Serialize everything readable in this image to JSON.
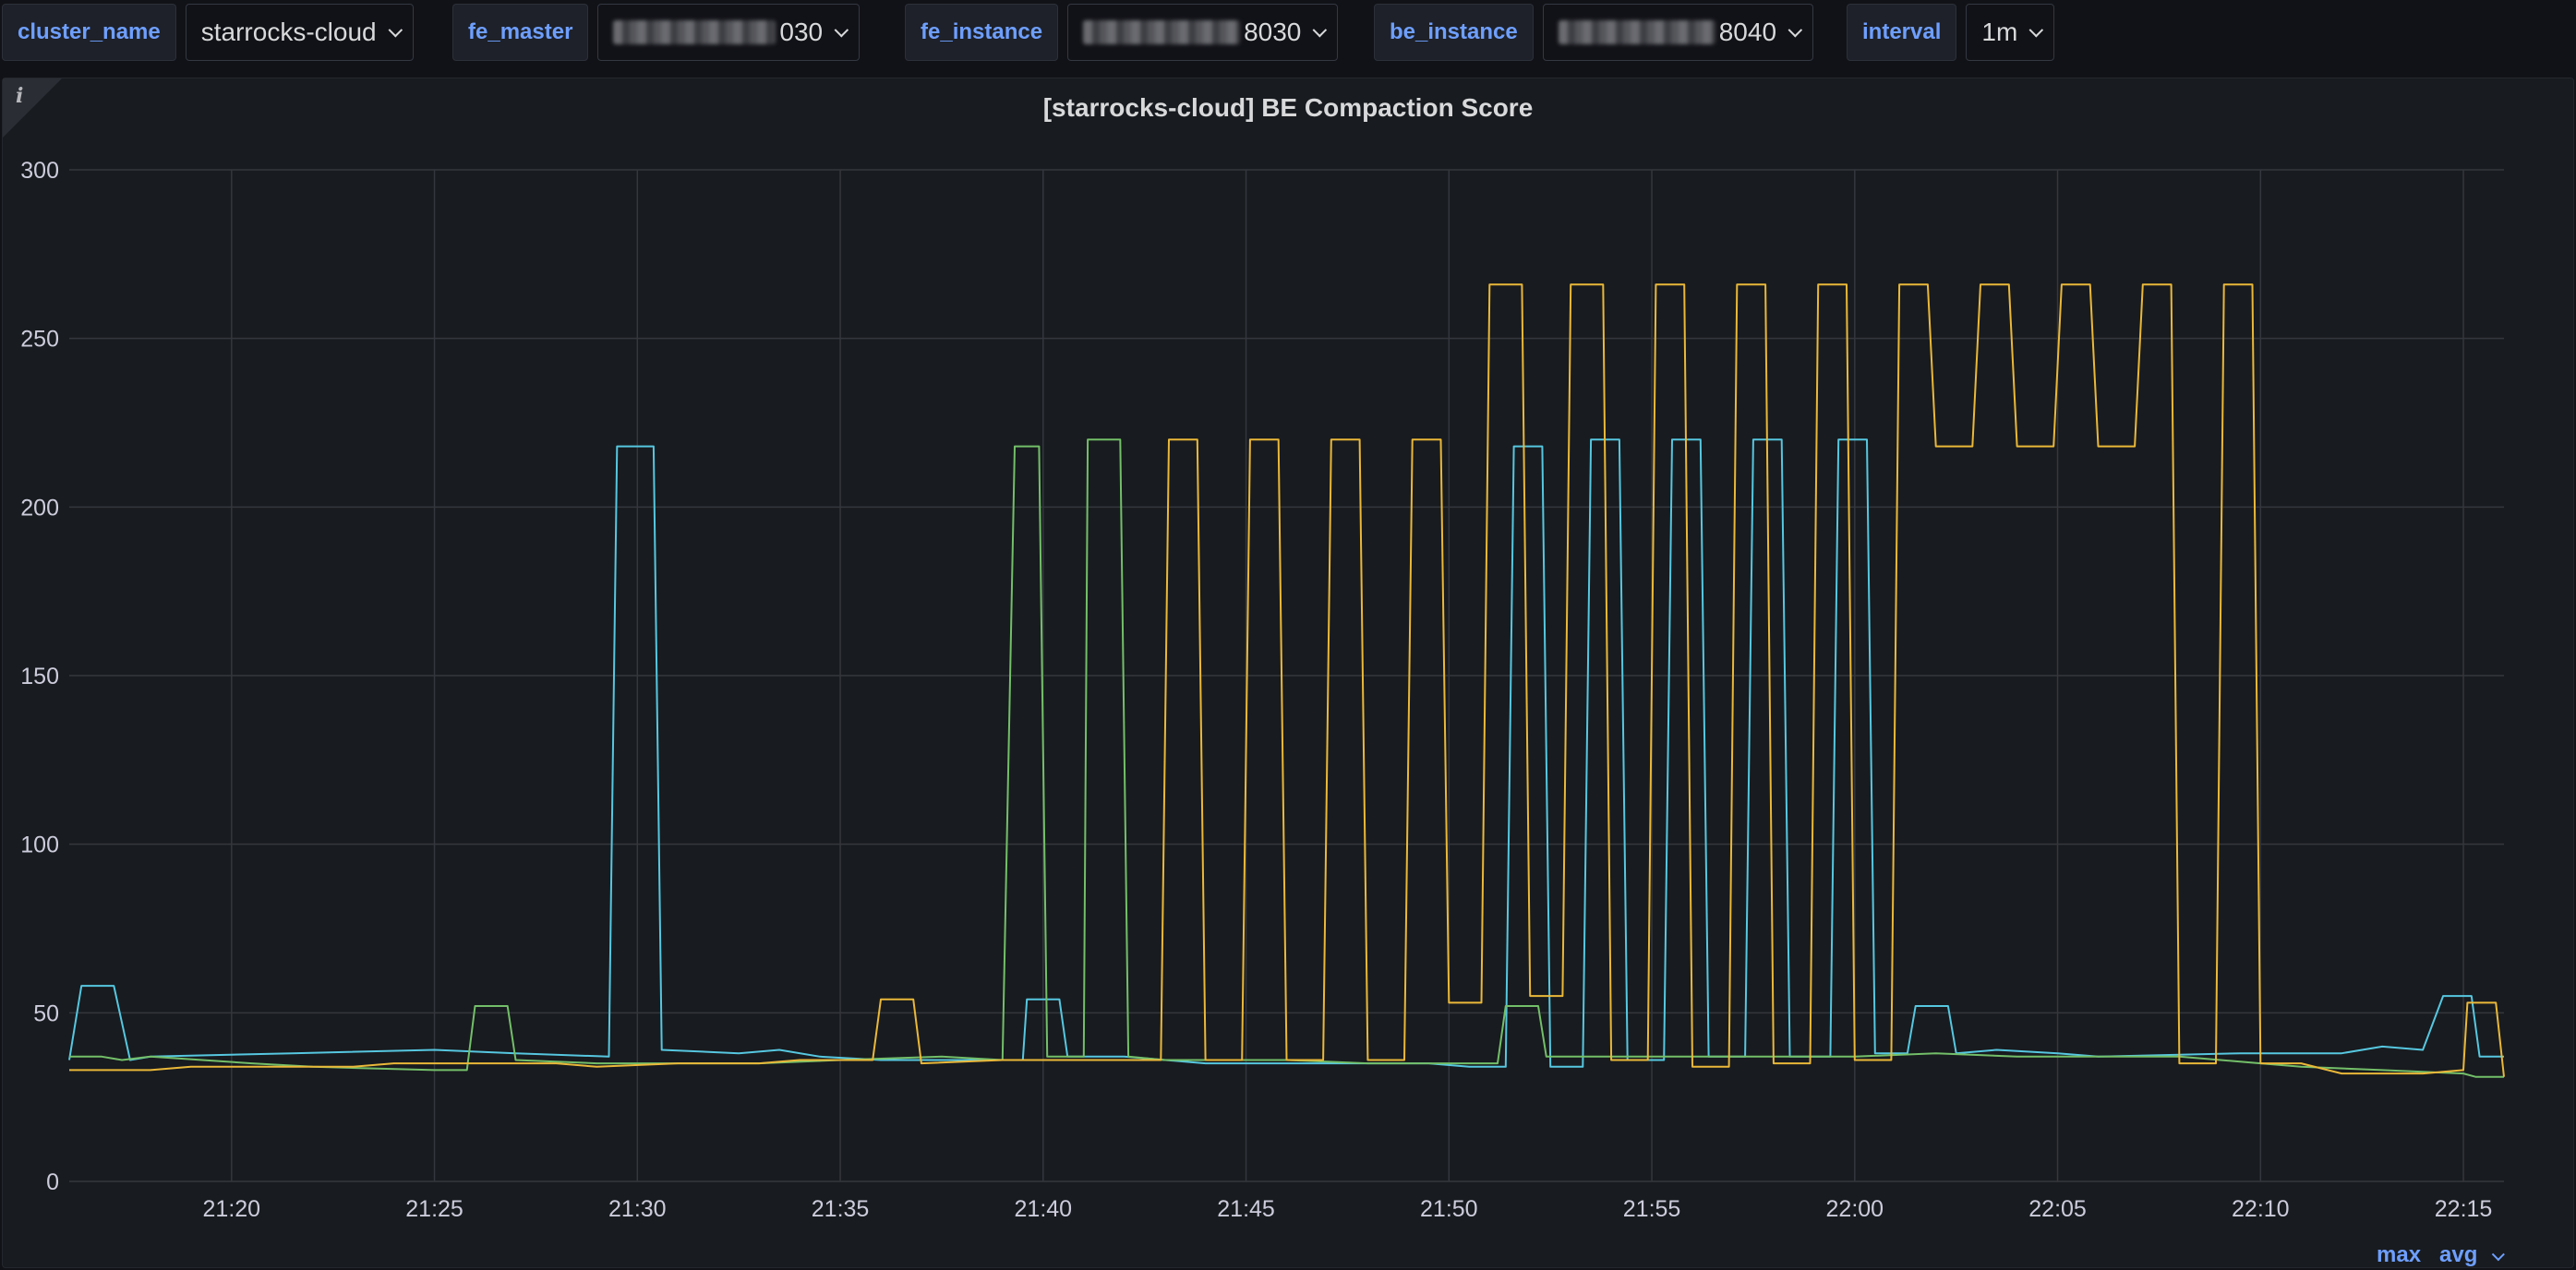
{
  "variables": [
    {
      "label": "cluster_name",
      "value": "starrocks-cloud",
      "masked": false
    },
    {
      "label": "fe_master",
      "value": "030",
      "masked": true
    },
    {
      "label": "fe_instance",
      "value": "8030",
      "masked": true
    },
    {
      "label": "be_instance",
      "value": "8040",
      "masked": true
    },
    {
      "label": "interval",
      "value": "1m",
      "masked": false
    }
  ],
  "panel": {
    "title": "[starrocks-cloud] BE Compaction Score",
    "info_icon": "info-icon",
    "legend_controls": [
      "max",
      "avg"
    ]
  },
  "colors": {
    "background": "#111217",
    "panel": "#181b1f",
    "accent": "#6e9fff",
    "grid": "#34373d"
  },
  "chart_data": {
    "type": "line",
    "title": "[starrocks-cloud] BE Compaction Score",
    "xlabel": "",
    "ylabel": "",
    "xlim": [
      "21:16",
      "22:16"
    ],
    "ylim": [
      0,
      300
    ],
    "y_ticks": [
      0,
      50,
      100,
      150,
      200,
      250,
      300
    ],
    "x_ticks": [
      "21:20",
      "21:25",
      "21:30",
      "21:35",
      "21:40",
      "21:45",
      "21:50",
      "21:55",
      "22:00",
      "22:05",
      "22:10",
      "22:15"
    ],
    "grid": true,
    "series": [
      {
        "color": "#56c7e0",
        "points": [
          [
            "21:16",
            36
          ],
          [
            "21:16.3",
            58
          ],
          [
            "21:17.1",
            58
          ],
          [
            "21:17.5",
            36
          ],
          [
            "21:18",
            37
          ],
          [
            "21:21.5",
            38
          ],
          [
            "21:25",
            39
          ],
          [
            "21:27",
            38
          ],
          [
            "21:29.3",
            37
          ],
          [
            "21:29.5",
            218
          ],
          [
            "21:30.4",
            218
          ],
          [
            "21:30.6",
            39
          ],
          [
            "21:32.5",
            38
          ],
          [
            "21:33.5",
            39
          ],
          [
            "21:34.5",
            37
          ],
          [
            "21:36",
            36
          ],
          [
            "21:39.5",
            36
          ],
          [
            "21:39.6",
            54
          ],
          [
            "21:40.4",
            54
          ],
          [
            "21:40.6",
            37
          ],
          [
            "21:42",
            37
          ],
          [
            "21:44",
            35
          ],
          [
            "21:47",
            35
          ],
          [
            "21:49.5",
            35
          ],
          [
            "21:50.5",
            34
          ],
          [
            "21:51.4",
            34
          ],
          [
            "21:51.6",
            218
          ],
          [
            "21:52.3",
            218
          ],
          [
            "21:52.5",
            34
          ],
          [
            "21:53.3",
            34
          ],
          [
            "21:53.5",
            220
          ],
          [
            "21:54.2",
            220
          ],
          [
            "21:54.4",
            36
          ],
          [
            "21:55.3",
            36
          ],
          [
            "21:55.5",
            220
          ],
          [
            "21:56.2",
            220
          ],
          [
            "21:56.4",
            37
          ],
          [
            "21:57.3",
            37
          ],
          [
            "21:57.5",
            220
          ],
          [
            "21:58.2",
            220
          ],
          [
            "21:58.4",
            37
          ],
          [
            "21:59.4",
            37
          ],
          [
            "21:59.6",
            220
          ],
          [
            "22:00.3",
            220
          ],
          [
            "22:00.5",
            38
          ],
          [
            "22:01.3",
            38
          ],
          [
            "22:01.5",
            52
          ],
          [
            "22:02.3",
            52
          ],
          [
            "22:02.5",
            38
          ],
          [
            "22:03.5",
            39
          ],
          [
            "22:05",
            38
          ],
          [
            "22:06",
            37
          ],
          [
            "22:09.5",
            38
          ],
          [
            "22:12",
            38
          ],
          [
            "22:13",
            40
          ],
          [
            "22:14",
            39
          ],
          [
            "22:14.5",
            55
          ],
          [
            "22:15.2",
            55
          ],
          [
            "22:15.4",
            37
          ],
          [
            "22:16",
            37
          ]
        ]
      },
      {
        "color": "#73bf69",
        "points": [
          [
            "21:16",
            37
          ],
          [
            "21:16.8",
            37
          ],
          [
            "21:17.3",
            36
          ],
          [
            "21:18",
            37
          ],
          [
            "21:20.5",
            35
          ],
          [
            "21:22",
            34
          ],
          [
            "21:25",
            33
          ],
          [
            "21:25.8",
            33
          ],
          [
            "21:26",
            52
          ],
          [
            "21:26.8",
            52
          ],
          [
            "21:27",
            36
          ],
          [
            "21:29",
            35
          ],
          [
            "21:31",
            35
          ],
          [
            "21:33",
            35
          ],
          [
            "21:35",
            36
          ],
          [
            "21:37.5",
            37
          ],
          [
            "21:39",
            36
          ],
          [
            "21:39.3",
            218
          ],
          [
            "21:39.9",
            218
          ],
          [
            "21:40.1",
            37
          ],
          [
            "21:41",
            37
          ],
          [
            "21:41.1",
            220
          ],
          [
            "21:41.9",
            220
          ],
          [
            "21:42.1",
            37
          ],
          [
            "21:43",
            36
          ],
          [
            "21:46",
            36
          ],
          [
            "21:48",
            35
          ],
          [
            "21:50",
            35
          ],
          [
            "21:51.2",
            35
          ],
          [
            "21:51.4",
            52
          ],
          [
            "21:52.2",
            52
          ],
          [
            "21:52.4",
            37
          ],
          [
            "21:55",
            37
          ],
          [
            "22:00",
            37
          ],
          [
            "22:02",
            38
          ],
          [
            "22:04",
            37
          ],
          [
            "22:06",
            37
          ],
          [
            "22:08",
            37
          ],
          [
            "22:10",
            35
          ],
          [
            "22:11",
            34
          ],
          [
            "22:13",
            33
          ],
          [
            "22:15",
            32
          ],
          [
            "22:15.3",
            31
          ],
          [
            "22:16",
            31
          ]
        ]
      },
      {
        "color": "#eab839",
        "points": [
          [
            "21:16",
            33
          ],
          [
            "21:18",
            33
          ],
          [
            "21:19",
            34
          ],
          [
            "21:21",
            34
          ],
          [
            "21:23",
            34
          ],
          [
            "21:24",
            35
          ],
          [
            "21:25.5",
            35
          ],
          [
            "21:26.5",
            35
          ],
          [
            "21:28",
            35
          ],
          [
            "21:29",
            34
          ],
          [
            "21:31",
            35
          ],
          [
            "21:33",
            35
          ],
          [
            "21:34",
            36
          ],
          [
            "21:35.8",
            36
          ],
          [
            "21:36",
            54
          ],
          [
            "21:36.8",
            54
          ],
          [
            "21:37",
            35
          ],
          [
            "21:39",
            36
          ],
          [
            "21:41",
            36
          ],
          [
            "21:42.9",
            36
          ],
          [
            "21:43.1",
            220
          ],
          [
            "21:43.8",
            220
          ],
          [
            "21:44",
            36
          ],
          [
            "21:44.9",
            36
          ],
          [
            "21:45.1",
            220
          ],
          [
            "21:45.8",
            220
          ],
          [
            "21:46",
            36
          ],
          [
            "21:46.9",
            36
          ],
          [
            "21:47.1",
            220
          ],
          [
            "21:47.8",
            220
          ],
          [
            "21:48",
            36
          ],
          [
            "21:48.9",
            36
          ],
          [
            "21:49.1",
            220
          ],
          [
            "21:49.8",
            220
          ],
          [
            "21:50",
            53
          ],
          [
            "21:50.8",
            53
          ],
          [
            "21:51",
            266
          ],
          [
            "21:51.8",
            266
          ],
          [
            "21:52",
            55
          ],
          [
            "21:52.8",
            55
          ],
          [
            "21:53",
            266
          ],
          [
            "21:53.8",
            266
          ],
          [
            "21:54",
            36
          ],
          [
            "21:54.9",
            36
          ],
          [
            "21:55.1",
            266
          ],
          [
            "21:55.8",
            266
          ],
          [
            "21:56",
            34
          ],
          [
            "21:56.9",
            34
          ],
          [
            "21:57.1",
            266
          ],
          [
            "21:57.8",
            266
          ],
          [
            "21:58",
            35
          ],
          [
            "21:58.9",
            35
          ],
          [
            "21:59.1",
            266
          ],
          [
            "21:59.8",
            266
          ],
          [
            "22:00",
            36
          ],
          [
            "22:00.9",
            36
          ],
          [
            "22:01.1",
            266
          ],
          [
            "22:01.8",
            266
          ],
          [
            "22:02",
            218
          ],
          [
            "22:02.9",
            218
          ],
          [
            "22:03.1",
            266
          ],
          [
            "22:03.8",
            266
          ],
          [
            "22:04",
            218
          ],
          [
            "22:04.9",
            218
          ],
          [
            "22:05.1",
            266
          ],
          [
            "22:05.8",
            266
          ],
          [
            "22:06",
            218
          ],
          [
            "22:06.9",
            218
          ],
          [
            "22:07.1",
            266
          ],
          [
            "22:07.8",
            266
          ],
          [
            "22:08",
            35
          ],
          [
            "22:08.9",
            35
          ],
          [
            "22:09.1",
            266
          ],
          [
            "22:09.8",
            266
          ],
          [
            "22:10",
            35
          ],
          [
            "22:11",
            35
          ],
          [
            "22:12",
            32
          ],
          [
            "22:14",
            32
          ],
          [
            "22:15",
            33
          ],
          [
            "22:15.1",
            53
          ],
          [
            "22:15.8",
            53
          ],
          [
            "22:16",
            31
          ]
        ]
      }
    ]
  }
}
